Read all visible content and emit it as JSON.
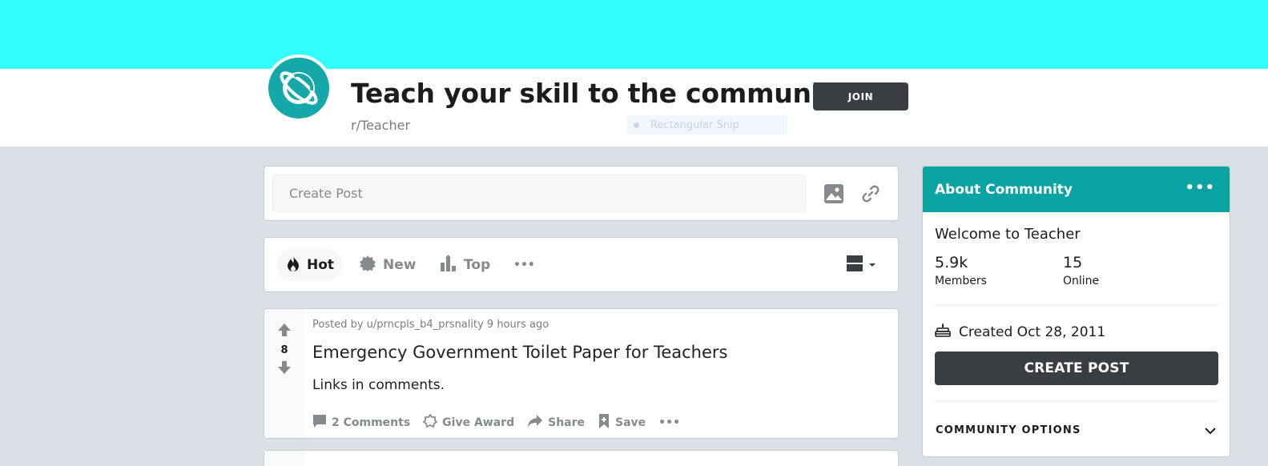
{
  "header": {
    "title": "Teach your skill to the community",
    "subreddit": "r/Teacher",
    "join_label": "JOIN",
    "overlay_label": "Rectangular Snip",
    "banner_color": "#33ffff",
    "avatar_color": "#14a8a8"
  },
  "create_post": {
    "placeholder": "Create Post",
    "image_icon": "image-icon",
    "link_icon": "link-icon"
  },
  "sort": {
    "hot": "Hot",
    "new": "New",
    "top": "Top",
    "more": "•••"
  },
  "post": {
    "votes": "8",
    "meta": "Posted by u/prncpls_b4_prsnality 9 hours ago",
    "title": "Emergency Government Toilet Paper for Teachers",
    "body": "Links in comments.",
    "comments": "2 Comments",
    "award": "Give Award",
    "share": "Share",
    "save": "Save",
    "more": "•••"
  },
  "about": {
    "heading": "About Community",
    "more": "•••",
    "welcome": "Welcome to Teacher",
    "members_count": "5.9k",
    "members_label": "Members",
    "online_count": "15",
    "online_label": "Online",
    "created": "Created Oct 28, 2011",
    "create_post_label": "CREATE POST",
    "options_label": "COMMUNITY OPTIONS",
    "accent_color": "#0aa3a3"
  }
}
